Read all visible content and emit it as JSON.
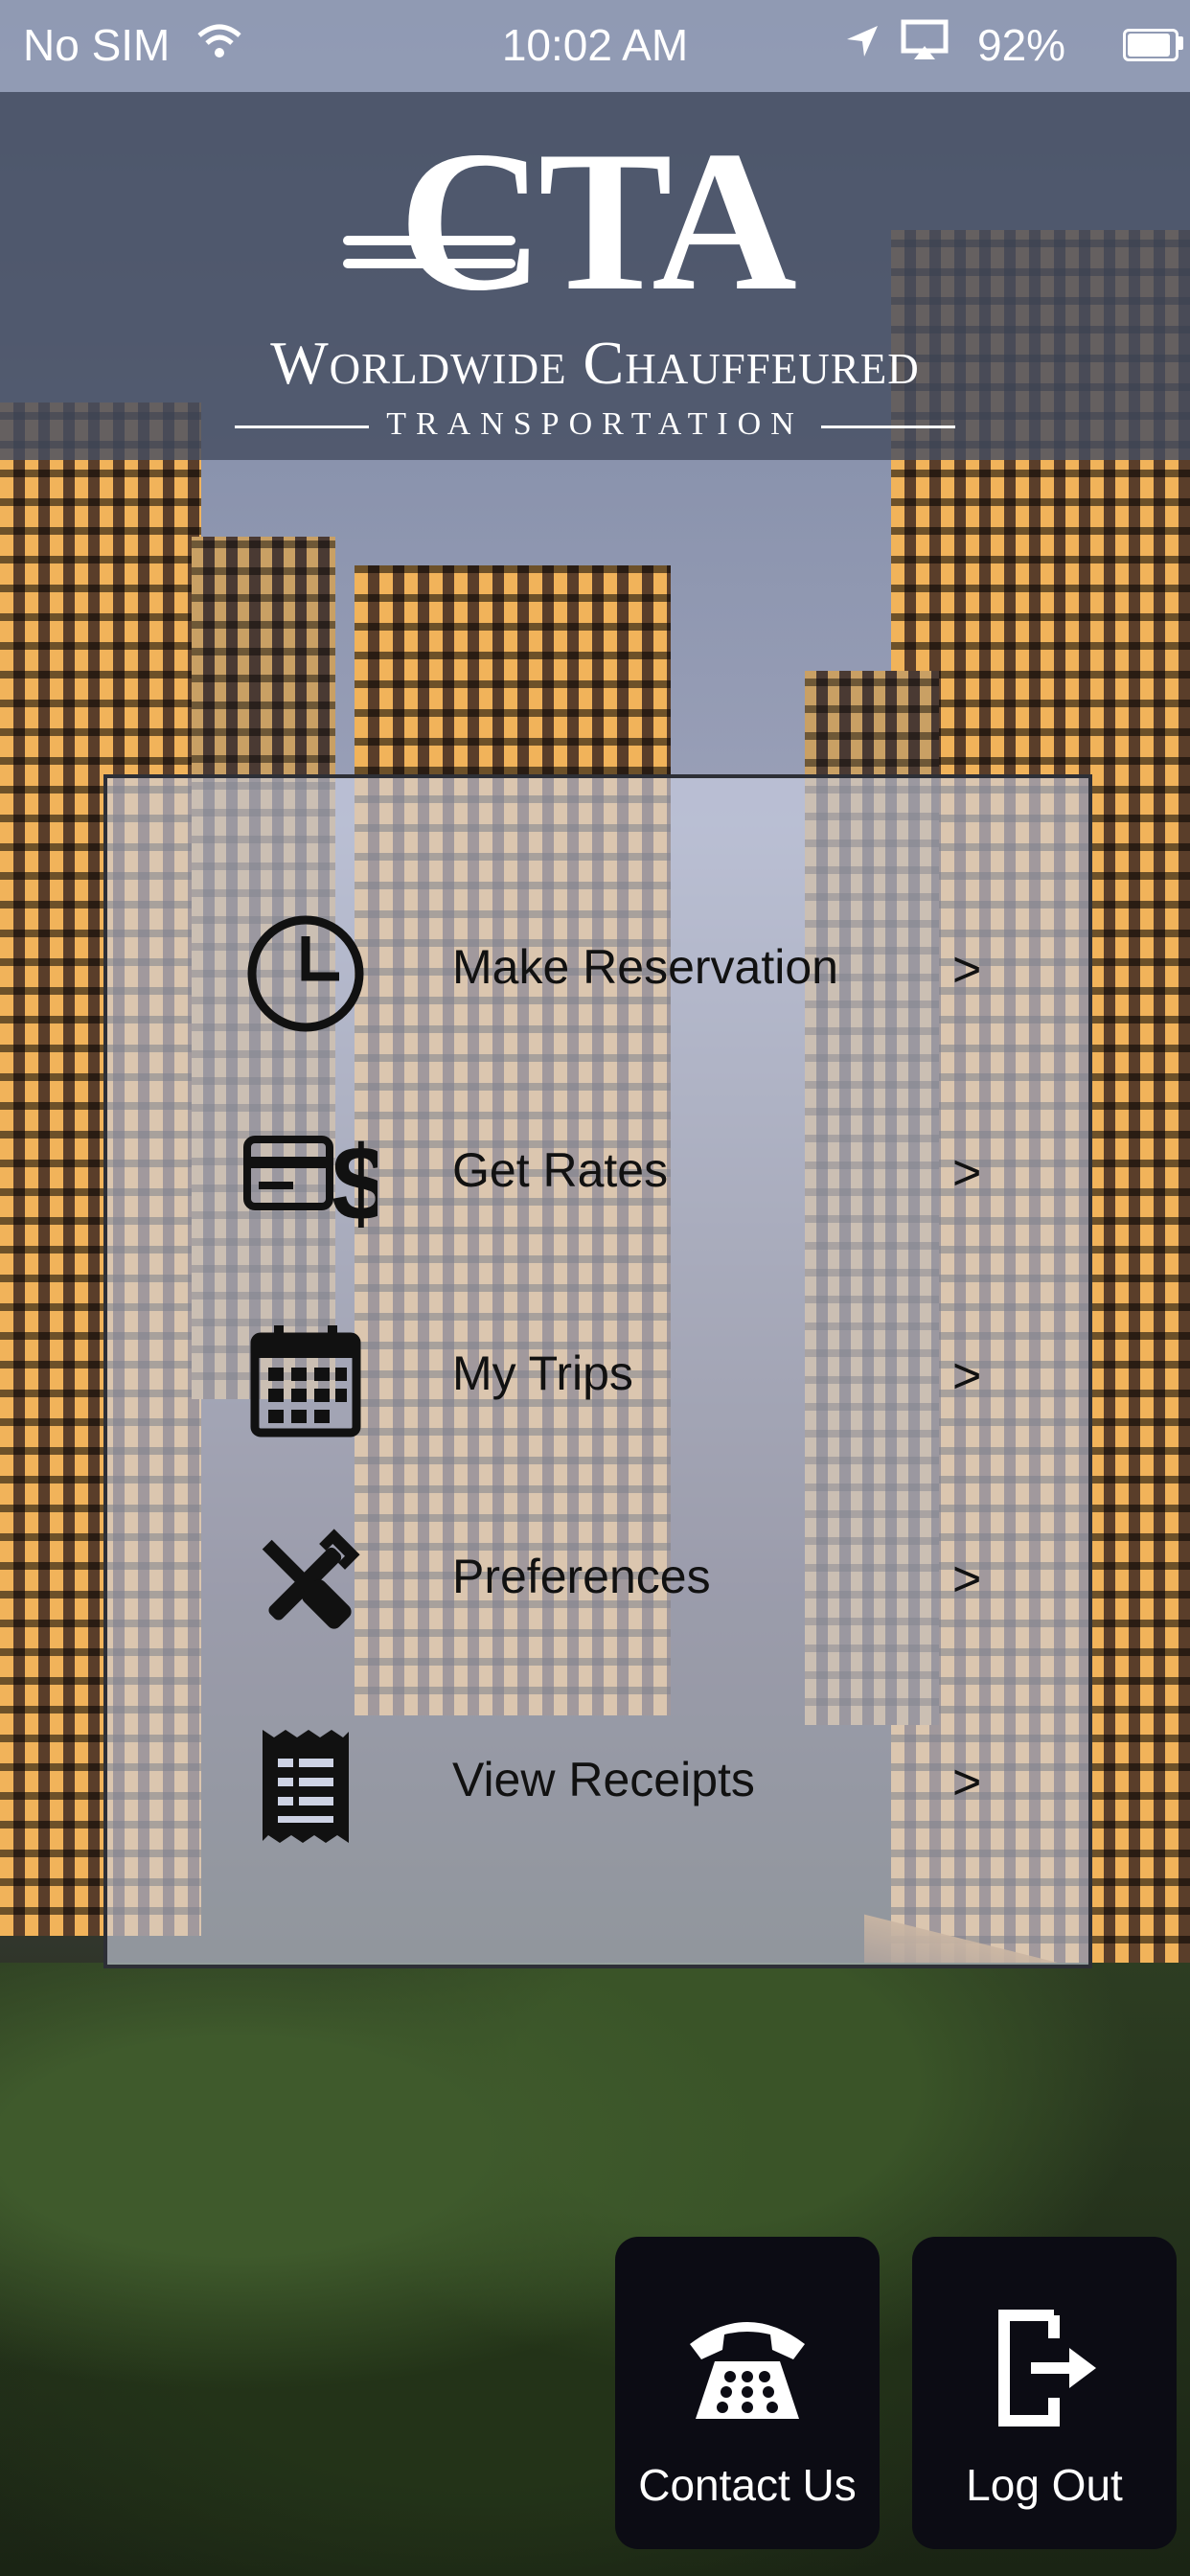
{
  "status_bar": {
    "carrier": "No SIM",
    "time": "10:02 AM",
    "battery": "92%"
  },
  "header": {
    "logo_mark": "CTA",
    "logo_name": "Worldwide Chauffeured",
    "logo_sub": "TRANSPORTATION"
  },
  "menu": {
    "items": [
      {
        "label": "Make Reservation",
        "icon": "clock-icon",
        "chevron": ">"
      },
      {
        "label": "Get Rates",
        "icon": "credit-card-dollar-icon",
        "chevron": ">"
      },
      {
        "label": "My Trips",
        "icon": "calendar-icon",
        "chevron": ">"
      },
      {
        "label": "Preferences",
        "icon": "wrench-screwdriver-icon",
        "chevron": ">"
      },
      {
        "label": "View Receipts",
        "icon": "receipt-icon",
        "chevron": ">"
      }
    ]
  },
  "bottom": {
    "contact_label": "Contact Us",
    "logout_label": "Log Out"
  },
  "colors": {
    "panel_bg": "#cdd2e4",
    "button_bg": "#0c0c14",
    "header_bg": "#464e62"
  }
}
